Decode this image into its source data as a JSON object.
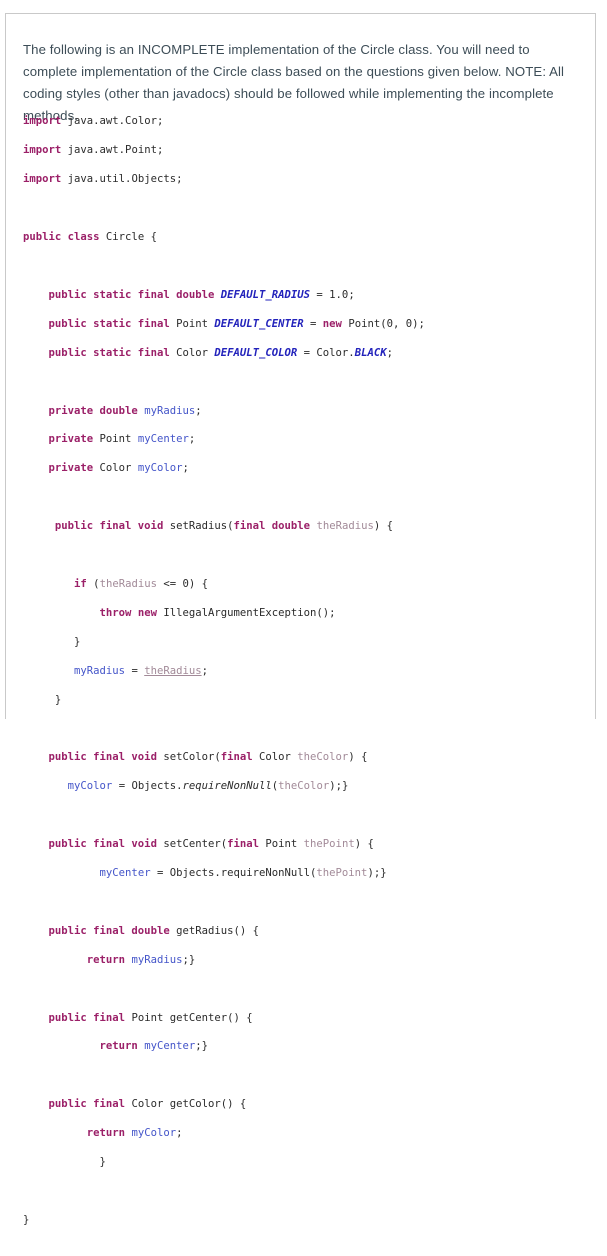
{
  "page": {
    "background": "#ffffff",
    "border_color": "#c9c9c9"
  },
  "intro": {
    "text": "The following is an INCOMPLETE implementation of the Circle class. You will need to complete implementation of the Circle class based on the questions given below. NOTE: All coding styles (other than javadocs) should be followed while implementing the incomplete methods.",
    "color": "#3d4d57"
  },
  "syntax_colors": {
    "keyword": "#9b2068",
    "constant": "#2222bb",
    "field": "#4455c9",
    "parameter": "#a28a98",
    "plain": "#2b2b2b"
  },
  "code": {
    "language": "java",
    "class_name": "Circle",
    "imports": [
      "import java.awt.Color;",
      "import java.awt.Point;",
      "import java.util.Objects;"
    ],
    "constants": [
      {
        "modifiers": "public static final",
        "type": "double",
        "name": "DEFAULT_RADIUS",
        "value": "1.0"
      },
      {
        "modifiers": "public static final",
        "type": "Point",
        "name": "DEFAULT_CENTER",
        "value": "new Point(0, 0)"
      },
      {
        "modifiers": "public static final",
        "type": "Color",
        "name": "DEFAULT_COLOR",
        "value": "Color.BLACK"
      }
    ],
    "fields": [
      {
        "modifiers": "private",
        "type": "double",
        "name": "myRadius"
      },
      {
        "modifiers": "private",
        "type": "Point",
        "name": "myCenter"
      },
      {
        "modifiers": "private",
        "type": "Color",
        "name": "myColor"
      }
    ],
    "methods": [
      {
        "signature": "public final void setRadius(final double theRadius) {",
        "name": "setRadius"
      },
      {
        "signature": "public final void setColor(final Color theColor) {",
        "name": "setColor"
      },
      {
        "signature": "public final void setCenter(final Point thePoint) {",
        "name": "setCenter"
      },
      {
        "signature": "public final double getRadius() {",
        "name": "getRadius"
      },
      {
        "signature": "public final Point getCenter() {",
        "name": "getCenter"
      },
      {
        "signature": "public final Color getColor() {",
        "name": "getColor"
      }
    ],
    "lines": [
      "import java.awt.Color;",
      "import java.awt.Point;",
      "import java.util.Objects;",
      "",
      "public class Circle {",
      "",
      "    public static final double DEFAULT_RADIUS = 1.0;",
      "    public static final Point DEFAULT_CENTER = new Point(0, 0);",
      "    public static final Color DEFAULT_COLOR = Color.BLACK;",
      "",
      "    private double myRadius;",
      "    private Point myCenter;",
      "    private Color myColor;",
      "",
      "     public final void setRadius(final double theRadius) {",
      "",
      "        if (theRadius <= 0) {",
      "            throw new IllegalArgumentException();",
      "        }",
      "        myRadius = theRadius;",
      "     }",
      "",
      "    public final void setColor(final Color theColor) {",
      "       myColor = Objects.requireNonNull(theColor);}",
      "",
      "    public final void setCenter(final Point thePoint) {",
      "            myCenter = Objects.requireNonNull(thePoint);}",
      "",
      "    public final double getRadius() {",
      "          return myRadius;}",
      "",
      "    public final Point getCenter() {",
      "            return myCenter;}",
      "",
      "    public final Color getColor() {",
      "          return myColor;",
      "            }",
      "",
      "}"
    ]
  }
}
